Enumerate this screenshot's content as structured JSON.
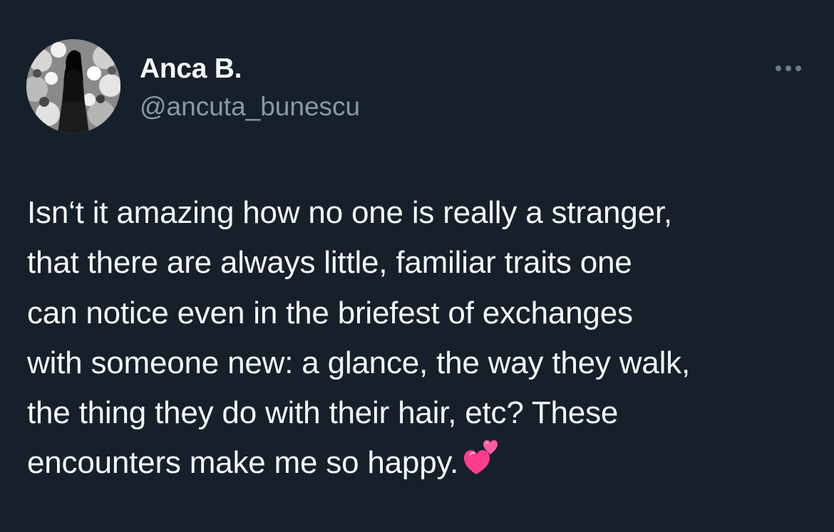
{
  "author": {
    "display_name": "Anca B.",
    "handle": "@ancuta_bunescu"
  },
  "menu": {
    "icon": "more-horizontal-icon"
  },
  "tweet": {
    "lines": [
      "Isn‘t it amazing how no one is really a stranger,",
      "that there are always little, familiar traits one",
      "can notice even in the briefest of exchanges",
      "with someone new: a glance, the way they walk,",
      "the thing they do with their hair, etc? These",
      "encounters make me so happy."
    ],
    "emoji": "two-hearts-emoji"
  },
  "colors": {
    "background": "#15202b",
    "primary_text": "#f7f9f9",
    "secondary_text": "#8b98a5",
    "emoji_pink": "#ff3c8e"
  }
}
